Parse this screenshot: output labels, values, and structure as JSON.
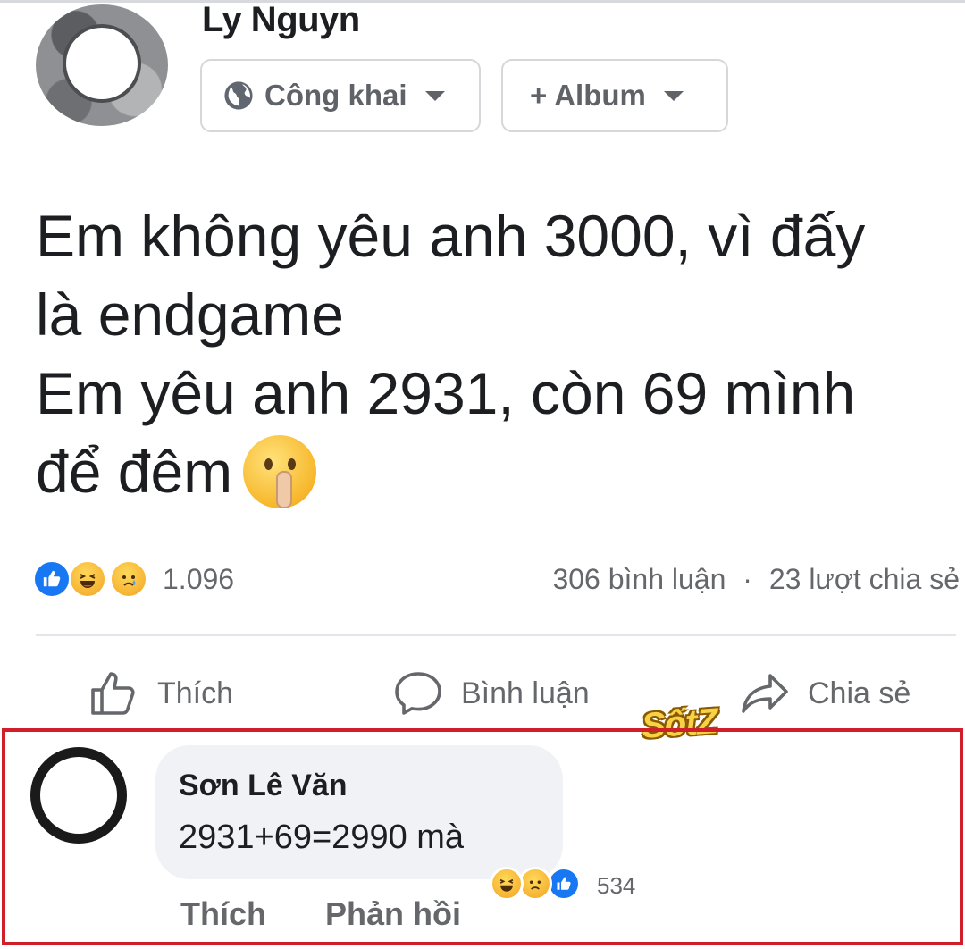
{
  "post": {
    "author": "Ly Nguyn",
    "privacy_label": "Công khai",
    "album_label": "+ Album",
    "text_lines": [
      "Em không yêu anh 3000, vì đấy",
      "là endgame",
      "Em yêu anh 2931, còn 69 mình",
      "để đêm"
    ],
    "emoji": "shushing-face",
    "reactions": [
      "like",
      "haha",
      "sad"
    ],
    "reaction_count": "1.096",
    "comment_count": "306 bình luận",
    "separator": "·",
    "share_count": "23 lượt chia sẻ"
  },
  "actions": {
    "like": "Thích",
    "comment": "Bình luận",
    "share": "Chia sẻ"
  },
  "watermark": "SốtZ",
  "comment": {
    "author": "Sơn Lê Văn",
    "text": "2931+69=2990 mà",
    "reactions": [
      "haha",
      "sad",
      "like"
    ],
    "reaction_count": "534",
    "like_label": "Thích",
    "reply_label": "Phản hồi"
  },
  "colors": {
    "highlight_border": "#d01f2a",
    "facebook_blue": "#1877f2",
    "secondary_text": "#65676b"
  }
}
